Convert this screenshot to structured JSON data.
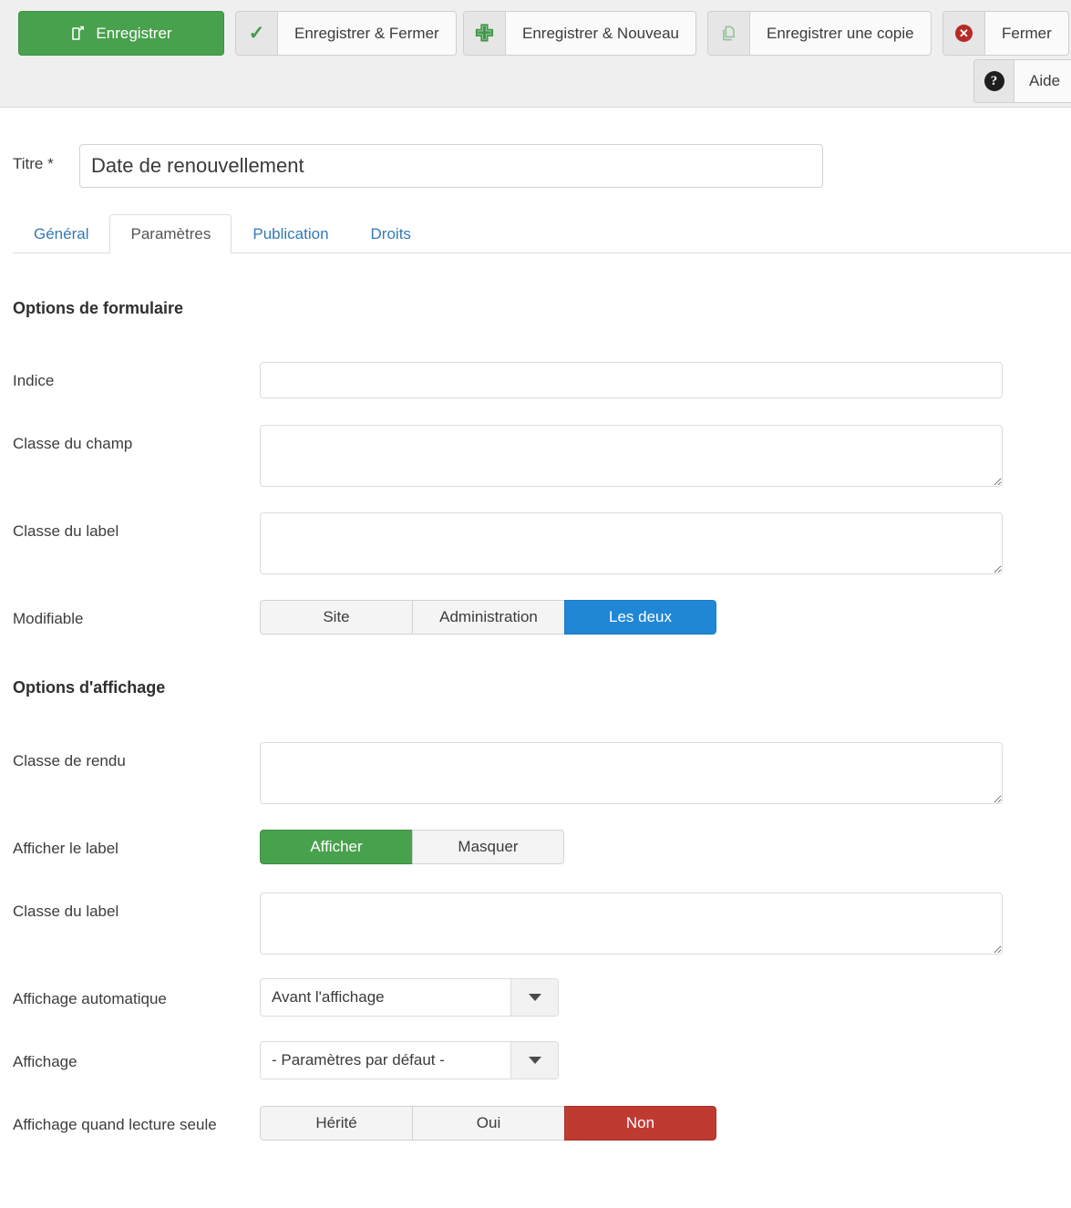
{
  "toolbar": {
    "buttons": [
      {
        "label": "Enregistrer",
        "icon": "edit-square-icon",
        "style": "primary"
      },
      {
        "label": "Enregistrer & Fermer",
        "icon": "check-icon",
        "style": "default"
      },
      {
        "label": "Enregistrer & Nouveau",
        "icon": "plus-icon",
        "style": "default"
      },
      {
        "label": "Enregistrer une copie",
        "icon": "copy-icon",
        "style": "default"
      },
      {
        "label": "Fermer",
        "icon": "close-circle-icon",
        "style": "default"
      }
    ],
    "help": {
      "label": "Aide",
      "icon": "question-circle-icon"
    }
  },
  "title_field": {
    "label": "Titre *",
    "value": "Date de renouvellement",
    "placeholder": ""
  },
  "tabs": [
    {
      "label": "Général",
      "active": false
    },
    {
      "label": "Paramètres",
      "active": true
    },
    {
      "label": "Publication",
      "active": false
    },
    {
      "label": "Droits",
      "active": false
    }
  ],
  "form_options": {
    "heading": "Options de formulaire",
    "indice": {
      "label": "Indice",
      "value": "",
      "placeholder": ""
    },
    "classe_champ": {
      "label": "Classe du champ",
      "value": "",
      "placeholder": ""
    },
    "classe_label": {
      "label": "Classe du label",
      "value": "",
      "placeholder": ""
    },
    "modifiable": {
      "label": "Modifiable",
      "options": [
        "Site",
        "Administration",
        "Les deux"
      ],
      "selected": "Les deux"
    }
  },
  "display_options": {
    "heading": "Options d'affichage",
    "classe_rendu": {
      "label": "Classe de rendu",
      "value": "",
      "placeholder": ""
    },
    "afficher_label": {
      "label": "Afficher le label",
      "options": [
        "Afficher",
        "Masquer"
      ],
      "selected": "Afficher"
    },
    "classe_label": {
      "label": "Classe du label",
      "value": "",
      "placeholder": ""
    },
    "affichage_automatique": {
      "label": "Affichage automatique",
      "selected": "Avant l'affichage"
    },
    "affichage": {
      "label": "Affichage",
      "selected": "- Paramètres par défaut -"
    },
    "lecture_seule": {
      "label": "Affichage quand lecture seule",
      "options": [
        "Hérité",
        "Oui",
        "Non"
      ],
      "selected": "Non"
    }
  },
  "colors": {
    "primary_green": "#48a14d",
    "accent_blue": "#2086d6",
    "danger_red": "#bf3a31",
    "tab_link": "#337ab7",
    "toolbar_bg": "#efefef"
  }
}
